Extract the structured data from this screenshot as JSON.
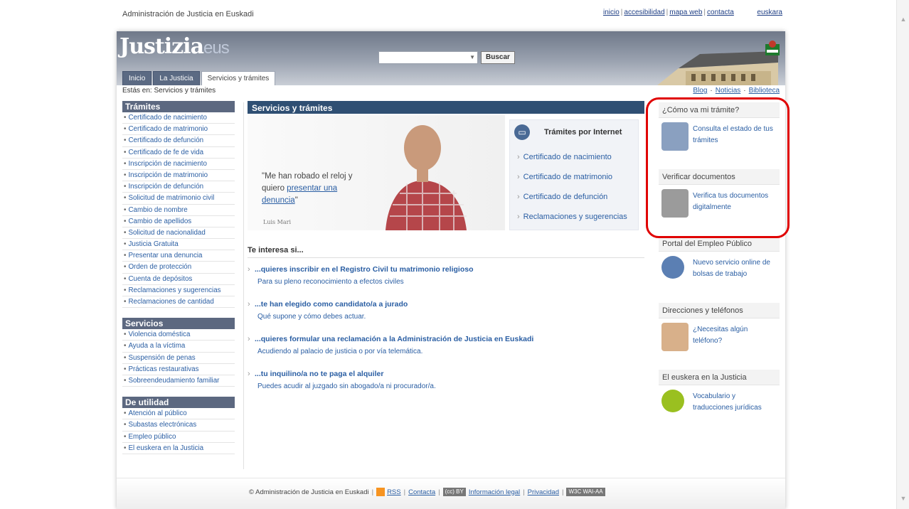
{
  "top": {
    "org": "Administración de Justicia en Euskadi",
    "links": [
      "inicio",
      "accesibilidad",
      "mapa web",
      "contacta"
    ],
    "lang": "euskara"
  },
  "header": {
    "logo_main": "Justizia",
    "logo_suffix": "eus",
    "search_button": "Buscar",
    "tabs": [
      "Inicio",
      "La Justicia",
      "Servicios y trámites"
    ]
  },
  "breadcrumb": "Estás en: Servicios y trámites",
  "toplinks": [
    "Blog",
    "Noticias",
    "Biblioteca"
  ],
  "sidebar": {
    "tramites": {
      "title": "Trámites",
      "items": [
        "Certificado de nacimiento",
        "Certificado de matrimonio",
        "Certificado de defunción",
        "Certificado de fe de vida",
        "Inscripción de nacimiento",
        "Inscripción de matrimonio",
        "Inscripción de defunción",
        "Solicitud de matrimonio civil",
        "Cambio de nombre",
        "Cambio de apellidos",
        "Solicitud de nacionalidad",
        "Justicia Gratuita",
        "Presentar una denuncia",
        "Orden de protección",
        "Cuenta de depósitos",
        "Reclamaciones y sugerencias",
        "Reclamaciones de cantidad"
      ]
    },
    "servicios": {
      "title": "Servicios",
      "items": [
        "Violencia doméstica",
        "Ayuda a la víctima",
        "Suspensión de penas",
        "Prácticas restaurativas",
        "Sobreendeudamiento familiar"
      ]
    },
    "utilidad": {
      "title": "De utilidad",
      "items": [
        "Atención al público",
        "Subastas electrónicas",
        "Empleo público",
        "El euskera en la Justicia"
      ]
    }
  },
  "main": {
    "title": "Servicios y trámites",
    "quote_pre": "\"Me han robado el reloj y quiero ",
    "quote_link": "presentar una denuncia",
    "quote_post": "\"",
    "author": "Luis Mari",
    "tramites_internet": {
      "title": "Trámites por Internet",
      "items": [
        "Certificado de nacimiento",
        "Certificado de matrimonio",
        "Certificado de defunción",
        "Reclamaciones y sugerencias"
      ]
    },
    "interest": {
      "title": "Te interesa si...",
      "items": [
        {
          "q": "...quieres inscribir en el Registro Civil tu matrimonio religioso",
          "a": "Para su pleno reconocimiento a efectos civiles"
        },
        {
          "q": "...te han elegido como candidato/a a jurado",
          "a": "Qué supone y cómo debes actuar."
        },
        {
          "q": "...quieres formular una reclamación a la Administración de Justicia en Euskadi",
          "a": "Acudiendo al palacio de justicia o por vía telemática."
        },
        {
          "q": "...tu inquilino/a no te paga el alquiler",
          "a": "Puedes acudir al juzgado sin abogado/a ni procurador/a."
        }
      ]
    }
  },
  "right": {
    "boxes": [
      {
        "title": "¿Cómo va mi trámite?",
        "text": "Consulta el estado de tus trámites"
      },
      {
        "title": "Verificar documentos",
        "text": "Verifica tus documentos digitalmente"
      },
      {
        "title": "Portal del Empleo Público",
        "text": "Nuevo servicio online de bolsas de trabajo"
      },
      {
        "title": "Direcciones y teléfonos",
        "text": "¿Necesitas algún teléfono?"
      },
      {
        "title": "El euskera en la Justicia",
        "text": "Vocabulario y traducciones jurídicas"
      }
    ]
  },
  "footer": {
    "copyright": "© Administración de Justicia en Euskadi",
    "rss": "RSS",
    "contacta": "Contacta",
    "cc_badge": "(cc) BY",
    "legal": "Información legal",
    "privacidad": "Privacidad",
    "w3c_badge": "W3C WAI-AA"
  },
  "colors": {
    "accent": "#2f4f73",
    "link": "#2a5ea3",
    "highlight": "#e00000"
  }
}
